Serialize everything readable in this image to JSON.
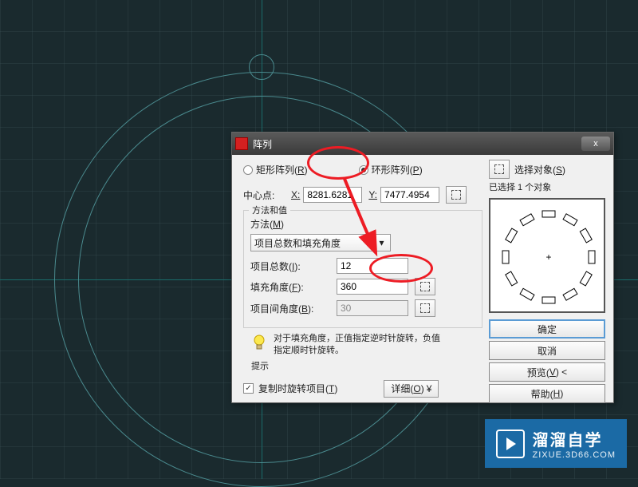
{
  "dialog": {
    "title": "阵列",
    "rect_array": "矩形阵列(R)",
    "polar_array": "环形阵列(P)",
    "select_objects": "选择对象(S)",
    "selected_count": "已选择 1 个对象",
    "center_label": "中心点:",
    "x_label": "X:",
    "x_value": "8281.6281",
    "y_label": "Y:",
    "y_value": "7477.4954",
    "method_group": "方法和值",
    "method_label": "方法(M)",
    "method_value": "项目总数和填充角度",
    "item_count_label": "项目总数(I):",
    "item_count_value": "12",
    "fill_angle_label": "填充角度(F):",
    "fill_angle_value": "360",
    "item_angle_label": "项目间角度(B):",
    "item_angle_value": "30",
    "tip_text": "对于填充角度，正值指定逆时针旋转，负值指定顺时针旋转。",
    "tip_label": "提示",
    "copy_rotate": "复制时旋转项目(T)",
    "detail_btn": "详细(O)",
    "ok_btn": "确定",
    "cancel_btn": "取消",
    "preview_btn": "预览(V) <",
    "help_btn": "帮助(H)"
  },
  "watermark": {
    "title": "溜溜自学",
    "sub": "ZIXUE.3D66.COM"
  }
}
